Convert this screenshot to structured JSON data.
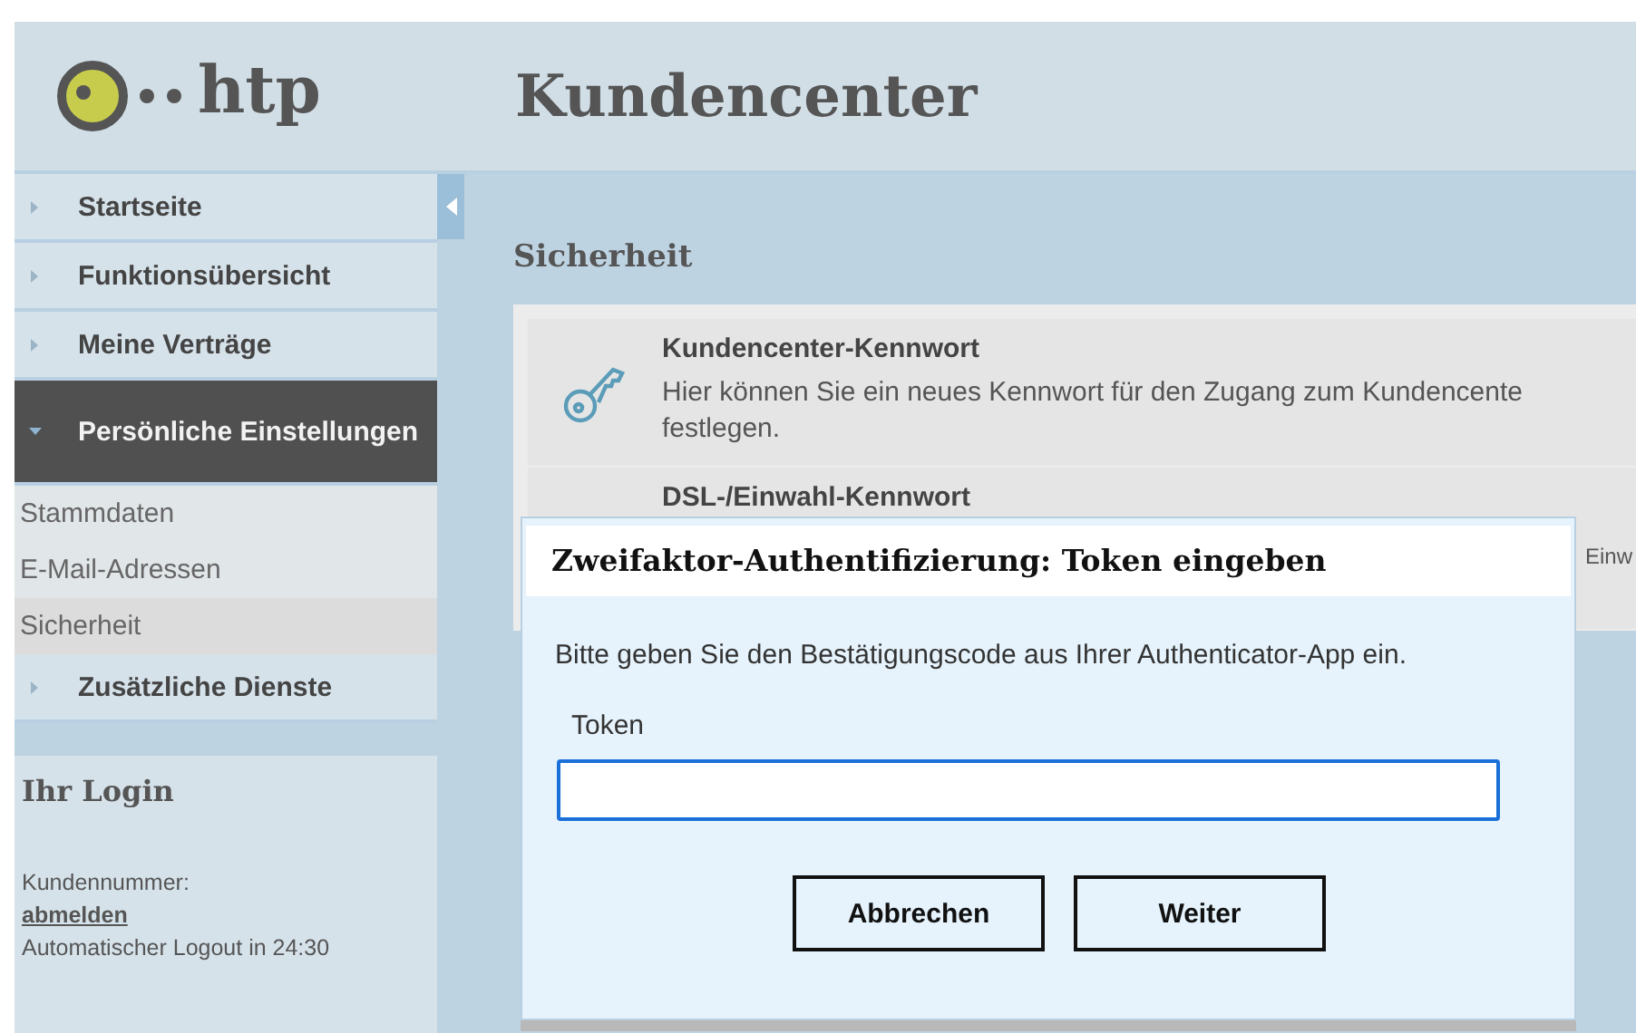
{
  "header": {
    "logo_text": "htp",
    "title": "Kundencenter"
  },
  "nav": [
    {
      "label": "Startseite",
      "expanded": false
    },
    {
      "label": "Funktionsübersicht",
      "expanded": false
    },
    {
      "label": "Meine Verträge",
      "expanded": false
    },
    {
      "label": "Persönliche Einstellungen",
      "expanded": true,
      "children": [
        {
          "label": "Stammdaten",
          "selected": false
        },
        {
          "label": "E-Mail-Adressen",
          "selected": false
        },
        {
          "label": "Sicherheit",
          "selected": true
        }
      ]
    },
    {
      "label": "Zusätzliche Dienste",
      "expanded": false
    }
  ],
  "login": {
    "title": "Ihr Login",
    "customer_label": "Kundennummer:",
    "logout_link": "abmelden",
    "timer": "Automatischer Logout in 24:30"
  },
  "main": {
    "heading": "Sicherheit",
    "items": [
      {
        "title": "Kundencenter-Kennwort",
        "text": "Hier können Sie ein neues Kennwort für den Zugang zum Kundencente festlegen."
      },
      {
        "title": "DSL-/Einwahl-Kennwort",
        "text": "Einw"
      }
    ]
  },
  "dialog": {
    "title": "Zweifaktor-Authentifizierung: Token eingeben",
    "message": "Bitte geben Sie den Bestätigungscode aus Ihrer Authenticator-App ein.",
    "field_label": "Token",
    "buttons": [
      "Abbrechen",
      "Weiter"
    ]
  }
}
